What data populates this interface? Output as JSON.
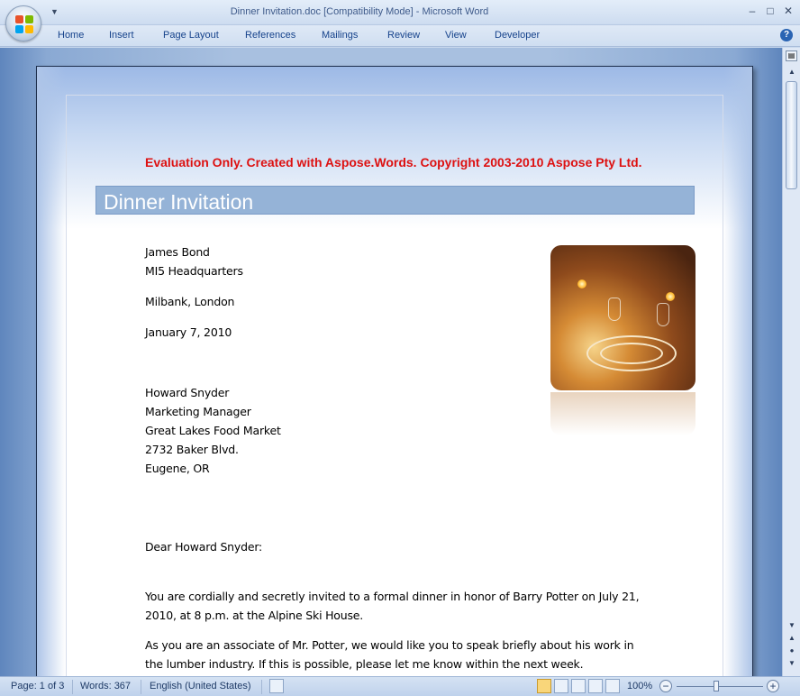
{
  "window": {
    "title": "Dinner Invitation.doc [Compatibility Mode] - Microsoft Word",
    "controls": [
      "minimize",
      "maximize",
      "close"
    ]
  },
  "ribbon": {
    "tabs": [
      "Home",
      "Insert",
      "Page Layout",
      "References",
      "Mailings",
      "Review",
      "View",
      "Developer"
    ],
    "help_symbol": "?"
  },
  "document": {
    "evaluation_notice": "Evaluation Only. Created with Aspose.Words. Copyright 2003-2010 Aspose Pty Ltd.",
    "heading": "Dinner Invitation",
    "sender_lines": [
      "James Bond",
      "MI5 Headquarters"
    ],
    "sender_city": "Milbank, London",
    "date": "January 7, 2010",
    "recipient_lines": [
      "Howard Snyder",
      "Marketing Manager",
      "Great Lakes Food Market",
      "2732 Baker Blvd.",
      "Eugene, OR"
    ],
    "salutation": "Dear Howard Snyder:",
    "body_lines": [
      "You are cordially and secretly invited to a formal dinner in honor of Barry Potter on July 21,",
      "2010, at 8 p.m. at the Alpine Ski House.",
      "As you are an associate of Mr. Potter, we would like you to speak briefly about his work in",
      "the lumber industry. If this is possible, please let me know within the next week."
    ],
    "image": "dinner-table-photo"
  },
  "statusbar": {
    "page": "Page: 1 of 3",
    "words": "Words: 367",
    "language": "English (United States)",
    "zoom": "100%",
    "zoom_level_percent": 100
  },
  "colors": {
    "evaluation_text": "#dd1111",
    "heading_bar": "#95b3d7",
    "ribbon_text": "#15428b"
  }
}
